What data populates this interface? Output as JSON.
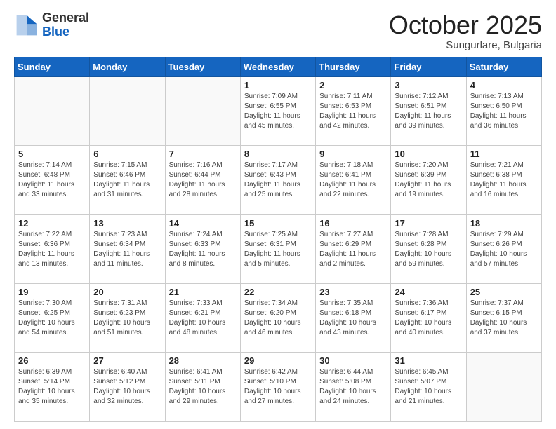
{
  "logo": {
    "general": "General",
    "blue": "Blue"
  },
  "header": {
    "month": "October 2025",
    "location": "Sungurlare, Bulgaria"
  },
  "weekdays": [
    "Sunday",
    "Monday",
    "Tuesday",
    "Wednesday",
    "Thursday",
    "Friday",
    "Saturday"
  ],
  "weeks": [
    [
      {
        "day": "",
        "info": ""
      },
      {
        "day": "",
        "info": ""
      },
      {
        "day": "",
        "info": ""
      },
      {
        "day": "1",
        "info": "Sunrise: 7:09 AM\nSunset: 6:55 PM\nDaylight: 11 hours\nand 45 minutes."
      },
      {
        "day": "2",
        "info": "Sunrise: 7:11 AM\nSunset: 6:53 PM\nDaylight: 11 hours\nand 42 minutes."
      },
      {
        "day": "3",
        "info": "Sunrise: 7:12 AM\nSunset: 6:51 PM\nDaylight: 11 hours\nand 39 minutes."
      },
      {
        "day": "4",
        "info": "Sunrise: 7:13 AM\nSunset: 6:50 PM\nDaylight: 11 hours\nand 36 minutes."
      }
    ],
    [
      {
        "day": "5",
        "info": "Sunrise: 7:14 AM\nSunset: 6:48 PM\nDaylight: 11 hours\nand 33 minutes."
      },
      {
        "day": "6",
        "info": "Sunrise: 7:15 AM\nSunset: 6:46 PM\nDaylight: 11 hours\nand 31 minutes."
      },
      {
        "day": "7",
        "info": "Sunrise: 7:16 AM\nSunset: 6:44 PM\nDaylight: 11 hours\nand 28 minutes."
      },
      {
        "day": "8",
        "info": "Sunrise: 7:17 AM\nSunset: 6:43 PM\nDaylight: 11 hours\nand 25 minutes."
      },
      {
        "day": "9",
        "info": "Sunrise: 7:18 AM\nSunset: 6:41 PM\nDaylight: 11 hours\nand 22 minutes."
      },
      {
        "day": "10",
        "info": "Sunrise: 7:20 AM\nSunset: 6:39 PM\nDaylight: 11 hours\nand 19 minutes."
      },
      {
        "day": "11",
        "info": "Sunrise: 7:21 AM\nSunset: 6:38 PM\nDaylight: 11 hours\nand 16 minutes."
      }
    ],
    [
      {
        "day": "12",
        "info": "Sunrise: 7:22 AM\nSunset: 6:36 PM\nDaylight: 11 hours\nand 13 minutes."
      },
      {
        "day": "13",
        "info": "Sunrise: 7:23 AM\nSunset: 6:34 PM\nDaylight: 11 hours\nand 11 minutes."
      },
      {
        "day": "14",
        "info": "Sunrise: 7:24 AM\nSunset: 6:33 PM\nDaylight: 11 hours\nand 8 minutes."
      },
      {
        "day": "15",
        "info": "Sunrise: 7:25 AM\nSunset: 6:31 PM\nDaylight: 11 hours\nand 5 minutes."
      },
      {
        "day": "16",
        "info": "Sunrise: 7:27 AM\nSunset: 6:29 PM\nDaylight: 11 hours\nand 2 minutes."
      },
      {
        "day": "17",
        "info": "Sunrise: 7:28 AM\nSunset: 6:28 PM\nDaylight: 10 hours\nand 59 minutes."
      },
      {
        "day": "18",
        "info": "Sunrise: 7:29 AM\nSunset: 6:26 PM\nDaylight: 10 hours\nand 57 minutes."
      }
    ],
    [
      {
        "day": "19",
        "info": "Sunrise: 7:30 AM\nSunset: 6:25 PM\nDaylight: 10 hours\nand 54 minutes."
      },
      {
        "day": "20",
        "info": "Sunrise: 7:31 AM\nSunset: 6:23 PM\nDaylight: 10 hours\nand 51 minutes."
      },
      {
        "day": "21",
        "info": "Sunrise: 7:33 AM\nSunset: 6:21 PM\nDaylight: 10 hours\nand 48 minutes."
      },
      {
        "day": "22",
        "info": "Sunrise: 7:34 AM\nSunset: 6:20 PM\nDaylight: 10 hours\nand 46 minutes."
      },
      {
        "day": "23",
        "info": "Sunrise: 7:35 AM\nSunset: 6:18 PM\nDaylight: 10 hours\nand 43 minutes."
      },
      {
        "day": "24",
        "info": "Sunrise: 7:36 AM\nSunset: 6:17 PM\nDaylight: 10 hours\nand 40 minutes."
      },
      {
        "day": "25",
        "info": "Sunrise: 7:37 AM\nSunset: 6:15 PM\nDaylight: 10 hours\nand 37 minutes."
      }
    ],
    [
      {
        "day": "26",
        "info": "Sunrise: 6:39 AM\nSunset: 5:14 PM\nDaylight: 10 hours\nand 35 minutes."
      },
      {
        "day": "27",
        "info": "Sunrise: 6:40 AM\nSunset: 5:12 PM\nDaylight: 10 hours\nand 32 minutes."
      },
      {
        "day": "28",
        "info": "Sunrise: 6:41 AM\nSunset: 5:11 PM\nDaylight: 10 hours\nand 29 minutes."
      },
      {
        "day": "29",
        "info": "Sunrise: 6:42 AM\nSunset: 5:10 PM\nDaylight: 10 hours\nand 27 minutes."
      },
      {
        "day": "30",
        "info": "Sunrise: 6:44 AM\nSunset: 5:08 PM\nDaylight: 10 hours\nand 24 minutes."
      },
      {
        "day": "31",
        "info": "Sunrise: 6:45 AM\nSunset: 5:07 PM\nDaylight: 10 hours\nand 21 minutes."
      },
      {
        "day": "",
        "info": ""
      }
    ]
  ]
}
